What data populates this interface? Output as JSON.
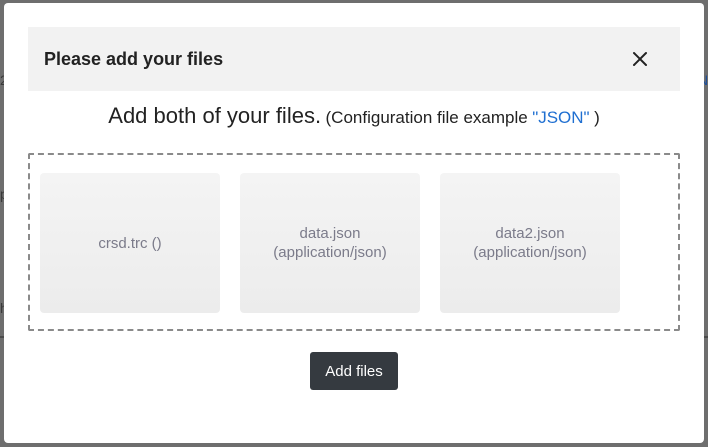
{
  "background": {
    "fragments": [
      "2",
      "p",
      "h",
      "N"
    ]
  },
  "modal": {
    "title": "Please add your files",
    "close_icon": "close-icon",
    "instructions": {
      "main": "Add both of your files.",
      "paren_open": "(Configuration file example",
      "link": "\"JSON\"",
      "paren_close": ")"
    },
    "files": [
      {
        "line1": "crsd.trc ()",
        "line2": ""
      },
      {
        "line1": "data.json",
        "line2": "(application/json)"
      },
      {
        "line1": "data2.json",
        "line2": "(application/json)"
      }
    ],
    "add_button_label": "Add files"
  },
  "colors": {
    "overlay": "#6e6e6e",
    "header_bg": "#f2f2f2",
    "link": "#1f6fd1",
    "button_bg": "#353a40",
    "card_text": "#7b7b8a"
  }
}
